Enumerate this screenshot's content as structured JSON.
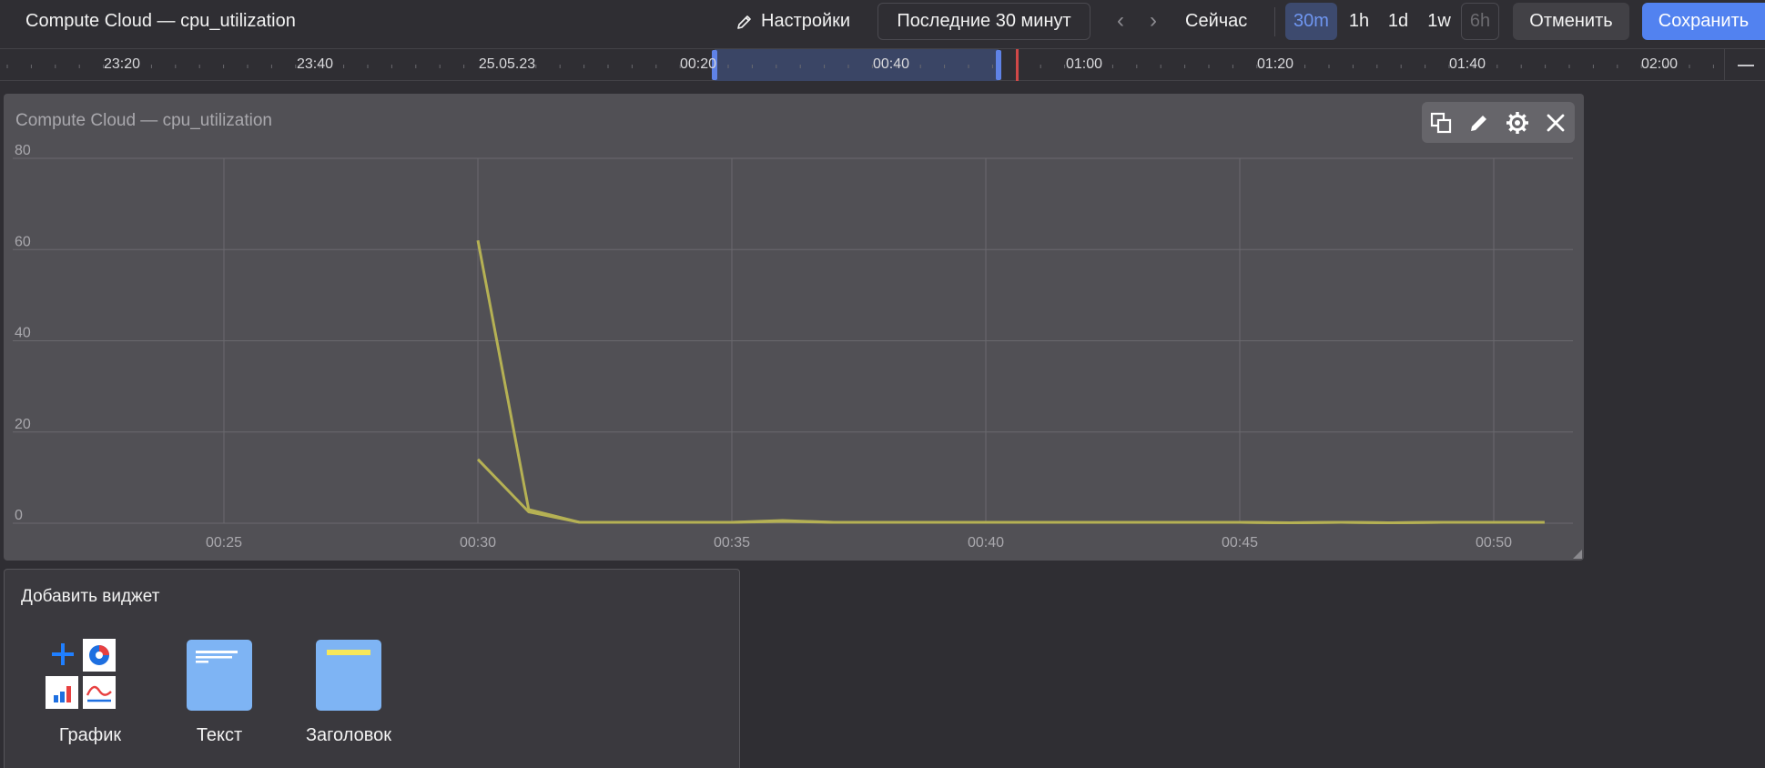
{
  "topbar": {
    "title": "Compute Cloud — cpu_utilization",
    "settings_label": "Настройки",
    "range_label": "Последние 30 минут",
    "now_label": "Сейчас",
    "scales": [
      "30m",
      "1h",
      "1d",
      "1w",
      "6h"
    ],
    "active_scale": "30m",
    "disabled_scale": "6h",
    "cancel_label": "Отменить",
    "save_label": "Сохранить"
  },
  "timeline": {
    "labels": [
      "23:20",
      "23:40",
      "25.05.23",
      "00:20",
      "00:40",
      "01:00",
      "01:20",
      "01:40",
      "02:00"
    ]
  },
  "widget": {
    "title": "Compute Cloud — cpu_utilization",
    "tools": [
      "copy-icon",
      "pencil-icon",
      "gear-icon",
      "close-icon"
    ]
  },
  "chart_data": {
    "type": "line",
    "x_ticks": [
      "00:25",
      "00:30",
      "00:35",
      "00:40",
      "00:45",
      "00:50"
    ],
    "y_ticks": [
      0,
      20,
      40,
      60,
      80
    ],
    "ylim": [
      0,
      80
    ],
    "grid": true,
    "color": "#b5b154",
    "series": [
      {
        "x": [
          "00:30",
          "00:31",
          "00:32",
          "00:33",
          "00:34",
          "00:35",
          "00:36",
          "00:37",
          "00:38",
          "00:39",
          "00:40",
          "00:41",
          "00:42",
          "00:43",
          "00:44",
          "00:45",
          "00:46",
          "00:47",
          "00:48",
          "00:49",
          "00:50",
          "00:51"
        ],
        "values": [
          62,
          3,
          0.2,
          0.2,
          0.2,
          0.2,
          0.6,
          0.2,
          0.2,
          0.2,
          0.2,
          0.2,
          0.2,
          0.2,
          0.2,
          0.2,
          0.1,
          0.2,
          0.1,
          0.2,
          0.2,
          0.2
        ]
      },
      {
        "x": [
          "00:30",
          "00:31",
          "00:32",
          "00:33",
          "00:34",
          "00:35",
          "00:36",
          "00:37",
          "00:38",
          "00:39",
          "00:40",
          "00:41",
          "00:42",
          "00:43",
          "00:44",
          "00:45",
          "00:46",
          "00:47",
          "00:48",
          "00:49",
          "00:50",
          "00:51"
        ],
        "values": [
          14,
          2.5,
          0.2,
          0.2,
          0.2,
          0.2,
          0.4,
          0.2,
          0.2,
          0.2,
          0.2,
          0.2,
          0.2,
          0.2,
          0.2,
          0.2,
          0.1,
          0.2,
          0.1,
          0.2,
          0.2,
          0.2
        ]
      }
    ]
  },
  "add_widget": {
    "title": "Добавить виджет",
    "items": [
      {
        "label": "График"
      },
      {
        "label": "Текст"
      },
      {
        "label": "Заголовок"
      }
    ]
  },
  "colors": {
    "accent": "#5282f0",
    "active_scale_bg": "#3d4a6e",
    "now_marker": "#d04848",
    "series": "#b5b154",
    "icon_blue": "#7eb4f4"
  }
}
